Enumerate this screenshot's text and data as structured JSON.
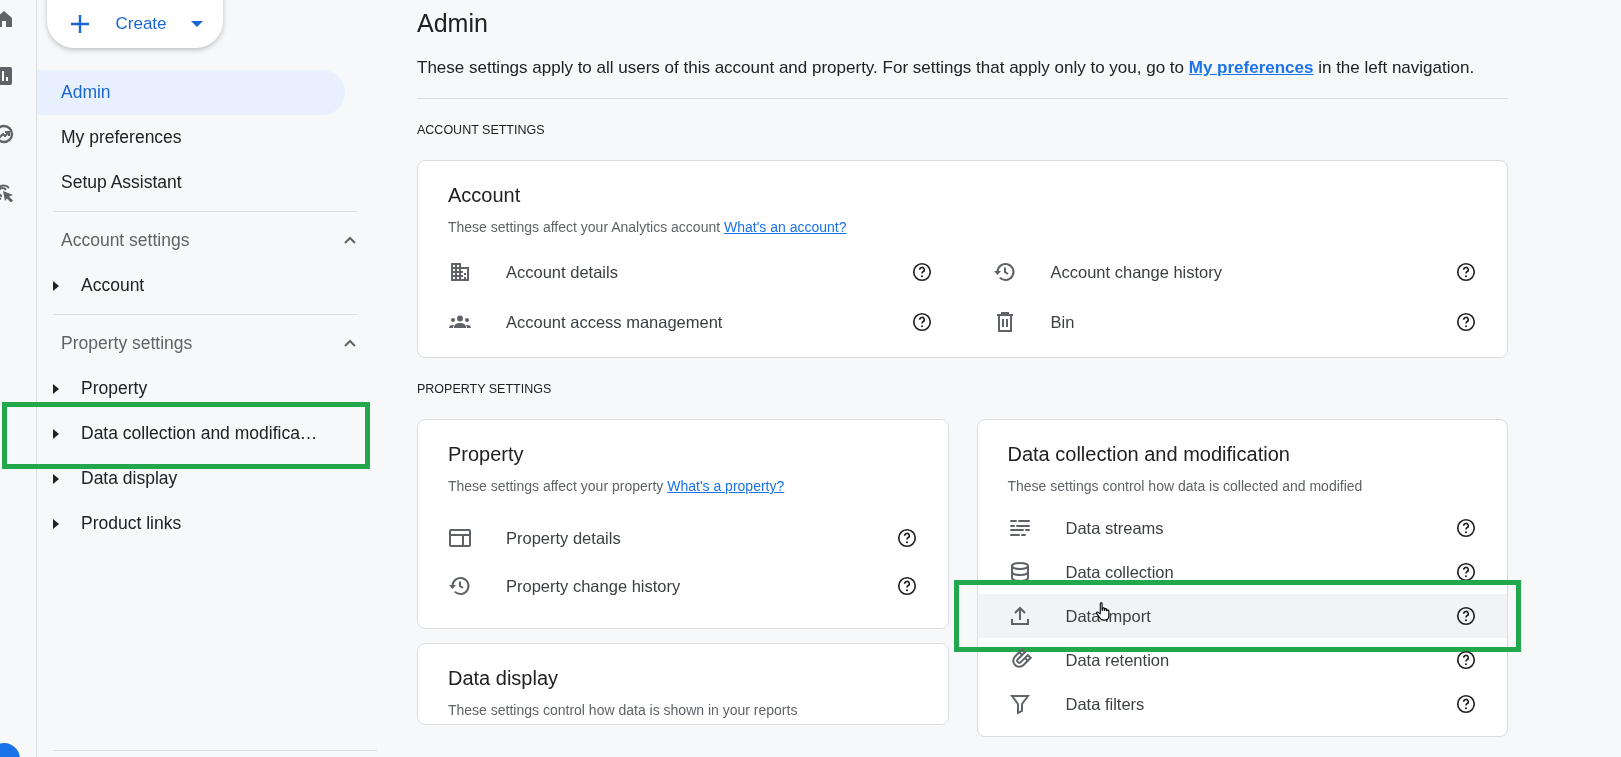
{
  "create_button": {
    "label": "Create"
  },
  "sidebar": {
    "nav": [
      {
        "label": "Admin",
        "selected": true
      },
      {
        "label": "My preferences",
        "selected": false
      },
      {
        "label": "Setup Assistant",
        "selected": false
      }
    ],
    "sections": [
      {
        "title": "Account settings",
        "expanded": true,
        "items": [
          {
            "label": "Account",
            "expanded": false,
            "highlighted": false
          }
        ]
      },
      {
        "title": "Property settings",
        "expanded": true,
        "items": [
          {
            "label": "Property",
            "expanded": false,
            "highlighted": false
          },
          {
            "label": "Data collection and modifica…",
            "expanded": false,
            "highlighted": true
          },
          {
            "label": "Data display",
            "expanded": false,
            "highlighted": false
          },
          {
            "label": "Product links",
            "expanded": false,
            "highlighted": false
          }
        ]
      }
    ]
  },
  "page": {
    "title": "Admin",
    "description": {
      "text_before": "These settings apply to all users of this account and property. For settings that apply only to you, go to",
      "link": "My preferences",
      "text_after": "in the left navigation."
    },
    "sections": [
      {
        "heading": "ACCOUNT SETTINGS",
        "columns": [
          [
            {
              "title": "Account",
              "subtitle": "These settings affect your Analytics account",
              "link": "What's an account?",
              "grid": true,
              "rows": [
                {
                  "label": "Account details",
                  "hovered": false,
                  "highlighted": false
                },
                {
                  "label": "Account change history",
                  "hovered": false,
                  "highlighted": false
                },
                {
                  "label": "Account access management",
                  "hovered": false,
                  "highlighted": false
                },
                {
                  "label": "Bin",
                  "hovered": false,
                  "highlighted": false
                }
              ]
            }
          ]
        ]
      },
      {
        "heading": "PROPERTY SETTINGS",
        "columns": [
          [
            {
              "title": "Property",
              "subtitle": "These settings affect your property",
              "link": "What's a property?",
              "grid": false,
              "rows": [
                {
                  "label": "Property details",
                  "hovered": false,
                  "highlighted": false
                },
                {
                  "label": "Property change history",
                  "hovered": false,
                  "highlighted": false
                }
              ]
            },
            {
              "title": "Data display",
              "subtitle": "These settings control how data is shown in your reports"
            }
          ],
          [
            {
              "title": "Data collection and modification",
              "subtitle": "These settings control how data is collected and modified",
              "grid": false,
              "rows": [
                {
                  "label": "Data streams",
                  "hovered": false,
                  "highlighted": false
                },
                {
                  "label": "Data collection",
                  "hovered": false,
                  "highlighted": false
                },
                {
                  "label": "Data import",
                  "hovered": true,
                  "highlighted": true
                },
                {
                  "label": "Data retention",
                  "hovered": false,
                  "highlighted": false
                },
                {
                  "label": "Data filters",
                  "hovered": false,
                  "highlighted": false
                }
              ]
            }
          ]
        ]
      }
    ]
  }
}
